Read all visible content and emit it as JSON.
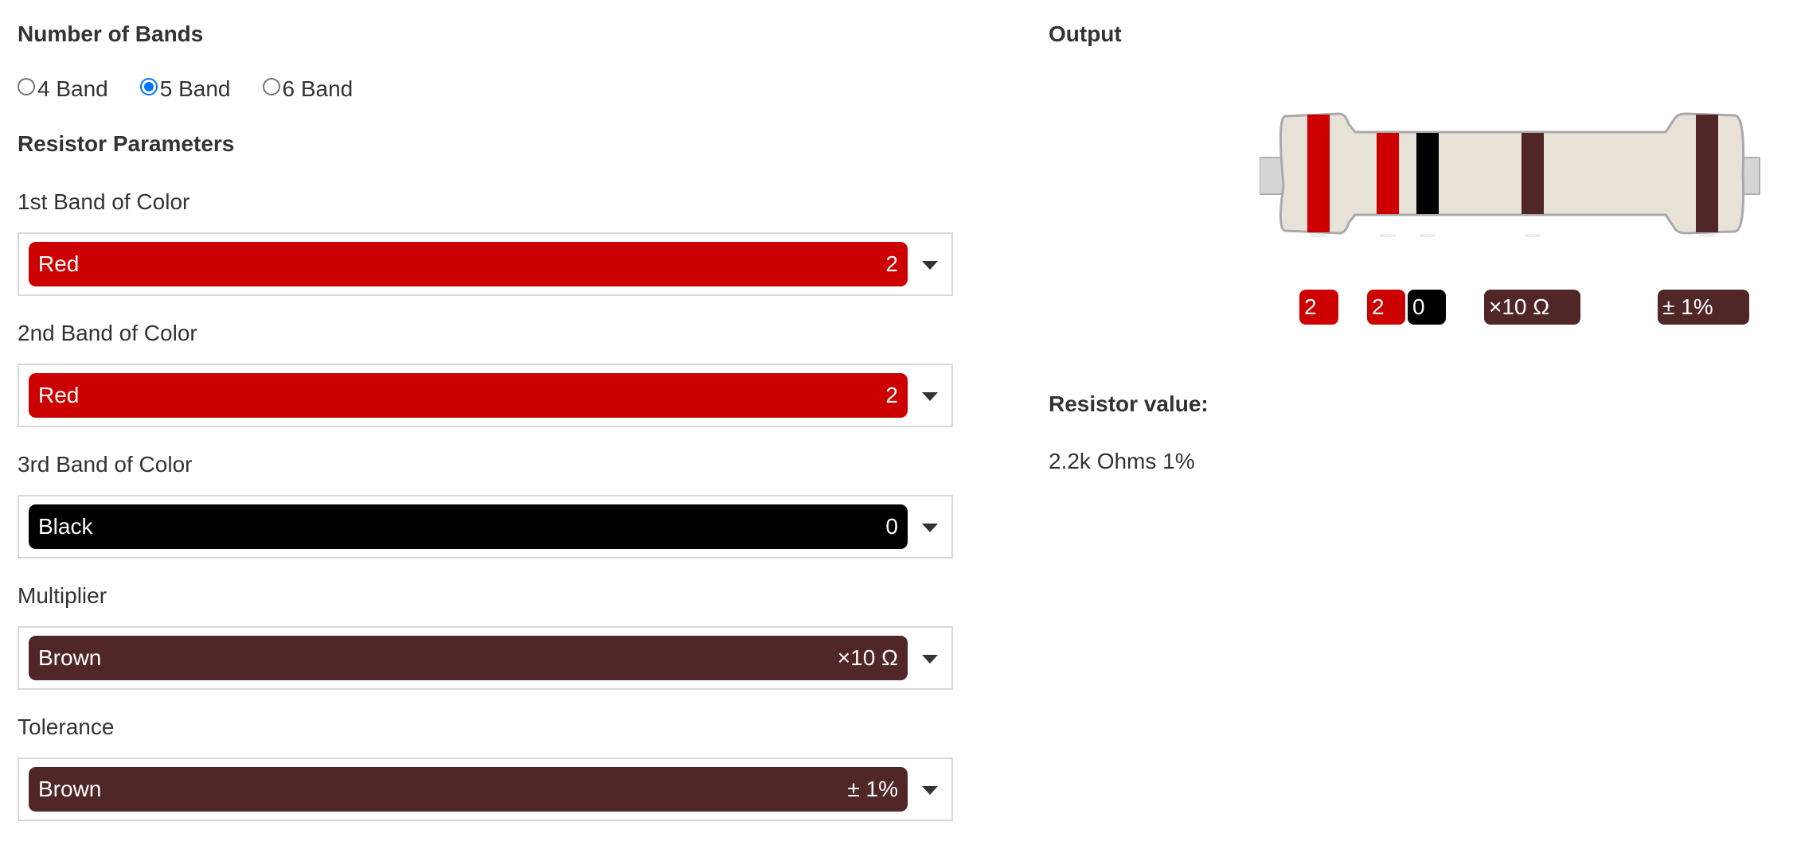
{
  "bands_section": {
    "title": "Number of Bands",
    "options": [
      {
        "label": "4 Band",
        "checked": false
      },
      {
        "label": "5 Band",
        "checked": true
      },
      {
        "label": "6 Band",
        "checked": false
      }
    ]
  },
  "params_section": {
    "title": "Resistor Parameters",
    "fields": [
      {
        "label": "1st Band of Color",
        "color_name": "Red",
        "value": "2",
        "color": "#cc0000"
      },
      {
        "label": "2nd Band of Color",
        "color_name": "Red",
        "value": "2",
        "color": "#cc0000"
      },
      {
        "label": "3rd Band of Color",
        "color_name": "Black",
        "value": "0",
        "color": "#000000"
      },
      {
        "label": "Multiplier",
        "color_name": "Brown",
        "value": "×10 Ω",
        "color": "#512627"
      },
      {
        "label": "Tolerance",
        "color_name": "Brown",
        "value": "± 1%",
        "color": "#512627"
      }
    ]
  },
  "output": {
    "title": "Output",
    "resistor": {
      "body_color": "#e8e2d8",
      "band_labels": [
        "2",
        "2",
        "0",
        "×10 Ω",
        "± 1%"
      ],
      "band_colors": [
        "#cc0000",
        "#cc0000",
        "#000000",
        "#512627",
        "#512627"
      ]
    },
    "value_heading": "Resistor value:",
    "value_text": "2.2k Ohms 1%"
  }
}
